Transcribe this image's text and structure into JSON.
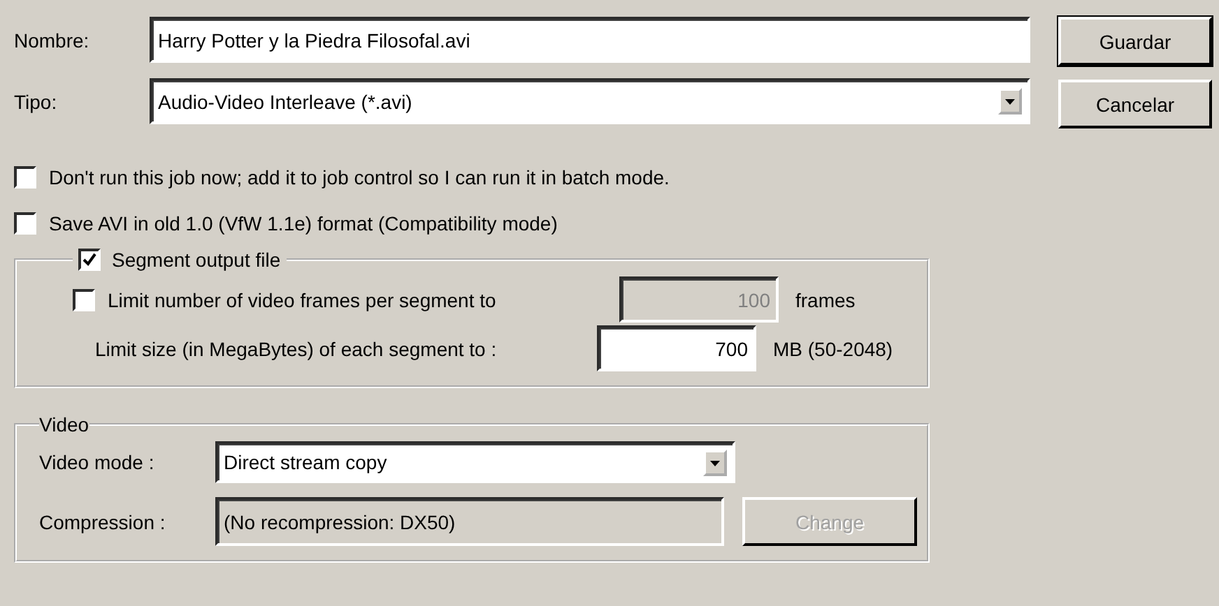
{
  "file_name": {
    "label": "Nombre:",
    "value": "Harry Potter y la Piedra Filosofal.avi"
  },
  "file_type": {
    "label": "Tipo:",
    "value": "Audio-Video Interleave (*.avi)"
  },
  "buttons": [
    {
      "label": "Guardar",
      "default": true
    },
    {
      "label": "Cancelar",
      "default": false
    }
  ],
  "options": [
    {
      "label": "Don't run this job now; add it to job control so I can run it in batch mode.",
      "checked": false
    },
    {
      "label": "Save AVI in old 1.0 (VfW 1.1e) format (Compatibility mode)",
      "checked": false
    }
  ],
  "segment": {
    "label": "Segment output file",
    "checked": true,
    "frames_limit": {
      "label": "Limit number of video frames per segment to",
      "checked": false,
      "value": "100",
      "disabled": true,
      "unit": "frames"
    },
    "size_limit": {
      "label": "Limit size (in MegaBytes) of each segment to :",
      "value": "700",
      "disabled": false,
      "unit": "MB (50-2048)"
    }
  },
  "video": {
    "title": "Video",
    "mode_label": "Video mode :",
    "mode": "Direct stream copy",
    "compression_label": "Compression :",
    "compression": "(No recompression: DX50)",
    "change_button": {
      "label": "Change",
      "disabled": true
    }
  }
}
